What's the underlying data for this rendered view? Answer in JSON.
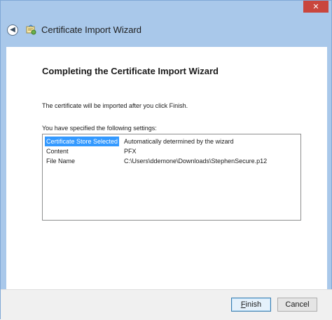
{
  "window": {
    "title": "Certificate Import Wizard",
    "close_glyph": "✕",
    "back_glyph": "◀",
    "icons": {
      "back": "back-arrow-icon",
      "certificate": "certificate-icon",
      "close": "close-icon"
    },
    "colors": {
      "frame": "#a9c8ea",
      "close_button": "#c9463d",
      "selection": "#3399ff"
    }
  },
  "wizard": {
    "heading": "Completing the Certificate Import Wizard",
    "info_text": "The certificate will be imported after you click Finish.",
    "settings_label": "You have specified the following settings:",
    "settings": [
      {
        "name": "Certificate Store Selected",
        "value": "Automatically determined by the wizard",
        "selected": true
      },
      {
        "name": "Content",
        "value": "PFX",
        "selected": false
      },
      {
        "name": "File Name",
        "value": "C:\\Users\\ddemone\\Downloads\\StephenSecure.p12",
        "selected": false
      }
    ]
  },
  "footer": {
    "finish": {
      "accel": "F",
      "rest": "inish"
    },
    "cancel": "Cancel"
  }
}
